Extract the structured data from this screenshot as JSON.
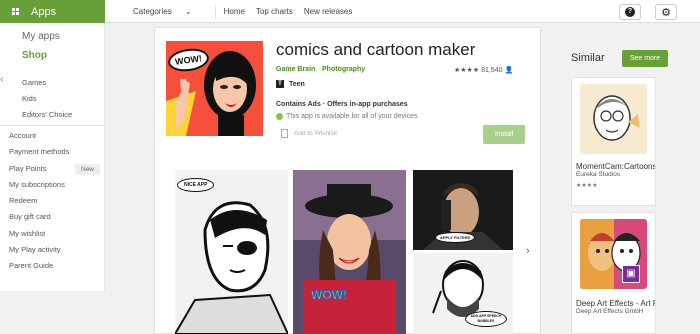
{
  "topbar": {
    "apps_label": "Apps",
    "categories_label": "Categories",
    "nav": [
      "Home",
      "Top charts",
      "New releases"
    ],
    "help_icon": "question-icon",
    "settings_icon": "gear-icon"
  },
  "sidebar": {
    "my_apps": "My apps",
    "shop": "Shop",
    "categories": [
      "Games",
      "Kids",
      "Editors' Choice"
    ],
    "links": [
      {
        "label": "Account"
      },
      {
        "label": "Payment methods"
      },
      {
        "label": "Play Points",
        "badge": "New"
      },
      {
        "label": "My subscriptions"
      },
      {
        "label": "Redeem"
      },
      {
        "label": "Buy gift card"
      },
      {
        "label": "My wishlist"
      },
      {
        "label": "My Play activity"
      },
      {
        "label": "Parent Guide"
      }
    ]
  },
  "app": {
    "title": "comics and cartoon maker",
    "developer": "Game Brain",
    "category": "Photography",
    "stars": "★★★★",
    "rating_count": "81,540",
    "content_rating": "Teen",
    "ads_notice": "Contains Ads · Offers in-app purchases",
    "availability": "This app is available for all of your devices",
    "wishlist_label": "Add to Wishlist",
    "install_label": "Install",
    "cover_text": "WOW!"
  },
  "screenshots": {
    "shot1_bubble": "NICE APP",
    "shot2_bubble": "WOW!",
    "shot3_bubble": "APPLY FILTERS",
    "shot4_bubble": "ADD APP SPEECH BUBBLES"
  },
  "similar": {
    "title": "Similar",
    "see_more": "See more",
    "items": [
      {
        "title": "MomentCam:Cartoons",
        "developer": "Eureka Studios",
        "stars": "★★★★"
      },
      {
        "title": "Deep Art Effects - Art Filter",
        "developer": "Deep Art Effects GmbH",
        "stars": ""
      }
    ]
  },
  "colors": {
    "brand_green": "#689f38",
    "install_disabled": "#a8d08d",
    "cover_red": "#f4503c"
  }
}
